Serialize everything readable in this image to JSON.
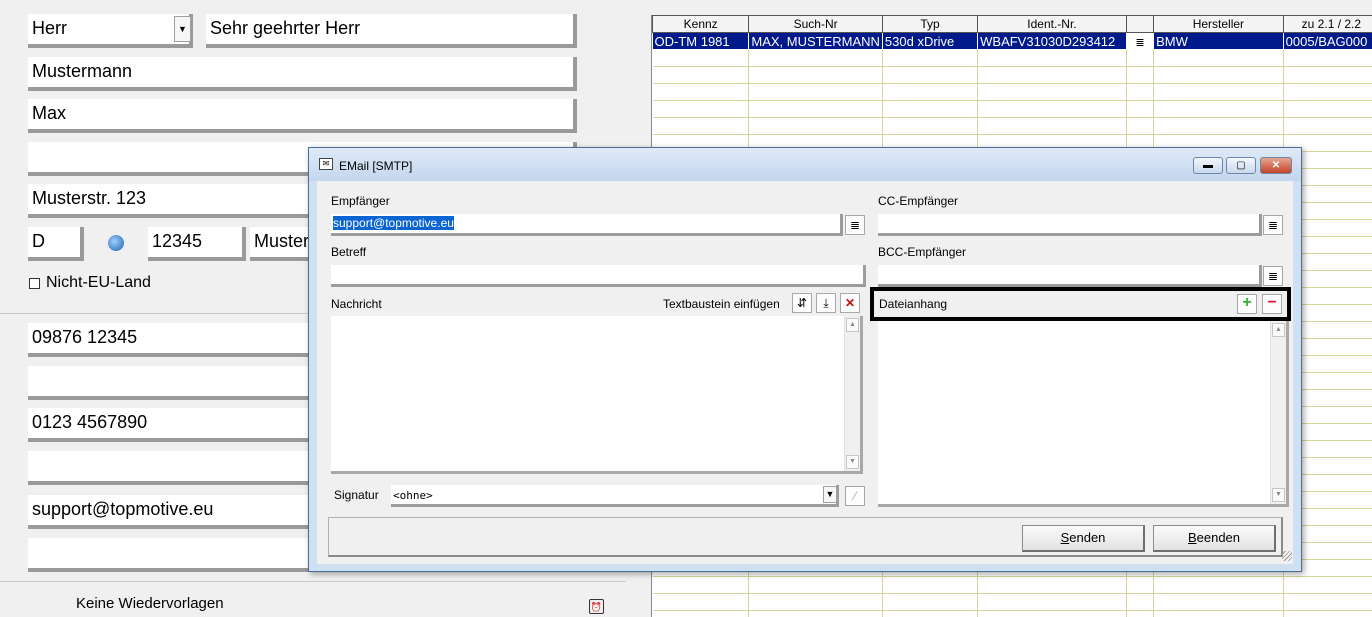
{
  "customer_form": {
    "salutation_value": "Herr",
    "letter_salutation": "Sehr geehrter Herr",
    "last_name": "Mustermann",
    "first_name": "Max",
    "name_extra": "",
    "street": "Musterstr. 123",
    "country_code": "D",
    "postal_code": "12345",
    "city": "Muster",
    "non_eu_label": "Nicht-EU-Land",
    "phone": "09876 12345",
    "phone2": "",
    "mobile": "0123 4567890",
    "fax": "",
    "email": "support@topmotive.eu",
    "email2": "",
    "reminder_text": "Keine Wiedervorlagen"
  },
  "vehicle_grid": {
    "columns": [
      "Kennz",
      "Such-Nr",
      "Typ",
      "Ident.-Nr.",
      "",
      "Hersteller",
      "zu 2.1 / 2.2"
    ],
    "rows": [
      [
        "OD-TM 1981",
        "MAX, MUSTERMANN",
        "530d xDrive",
        "WBAFV31030D293412",
        "",
        "BMW",
        "0005/BAG000"
      ]
    ]
  },
  "email_dialog": {
    "title": "EMail [SMTP]",
    "recipient_label": "Empfänger",
    "recipient_value": "support@topmotive.eu",
    "cc_label": "CC-Empfänger",
    "cc_value": "",
    "bcc_label": "BCC-Empfänger",
    "bcc_value": "",
    "subject_label": "Betreff",
    "subject_value": "",
    "message_label": "Nachricht",
    "insert_snippet_label": "Textbaustein einfügen",
    "attachment_label": "Dateianhang",
    "signature_label": "Signatur",
    "signature_value": "<ohne>",
    "send_label_u": "S",
    "send_label_rest": "enden",
    "quit_label_u": "B",
    "quit_label_rest": "eenden"
  },
  "colors": {
    "selection": "#001a8c",
    "highlight_frame": "#000000",
    "add_icon": "#2fb02f",
    "remove_icon": "#d81a3a"
  }
}
